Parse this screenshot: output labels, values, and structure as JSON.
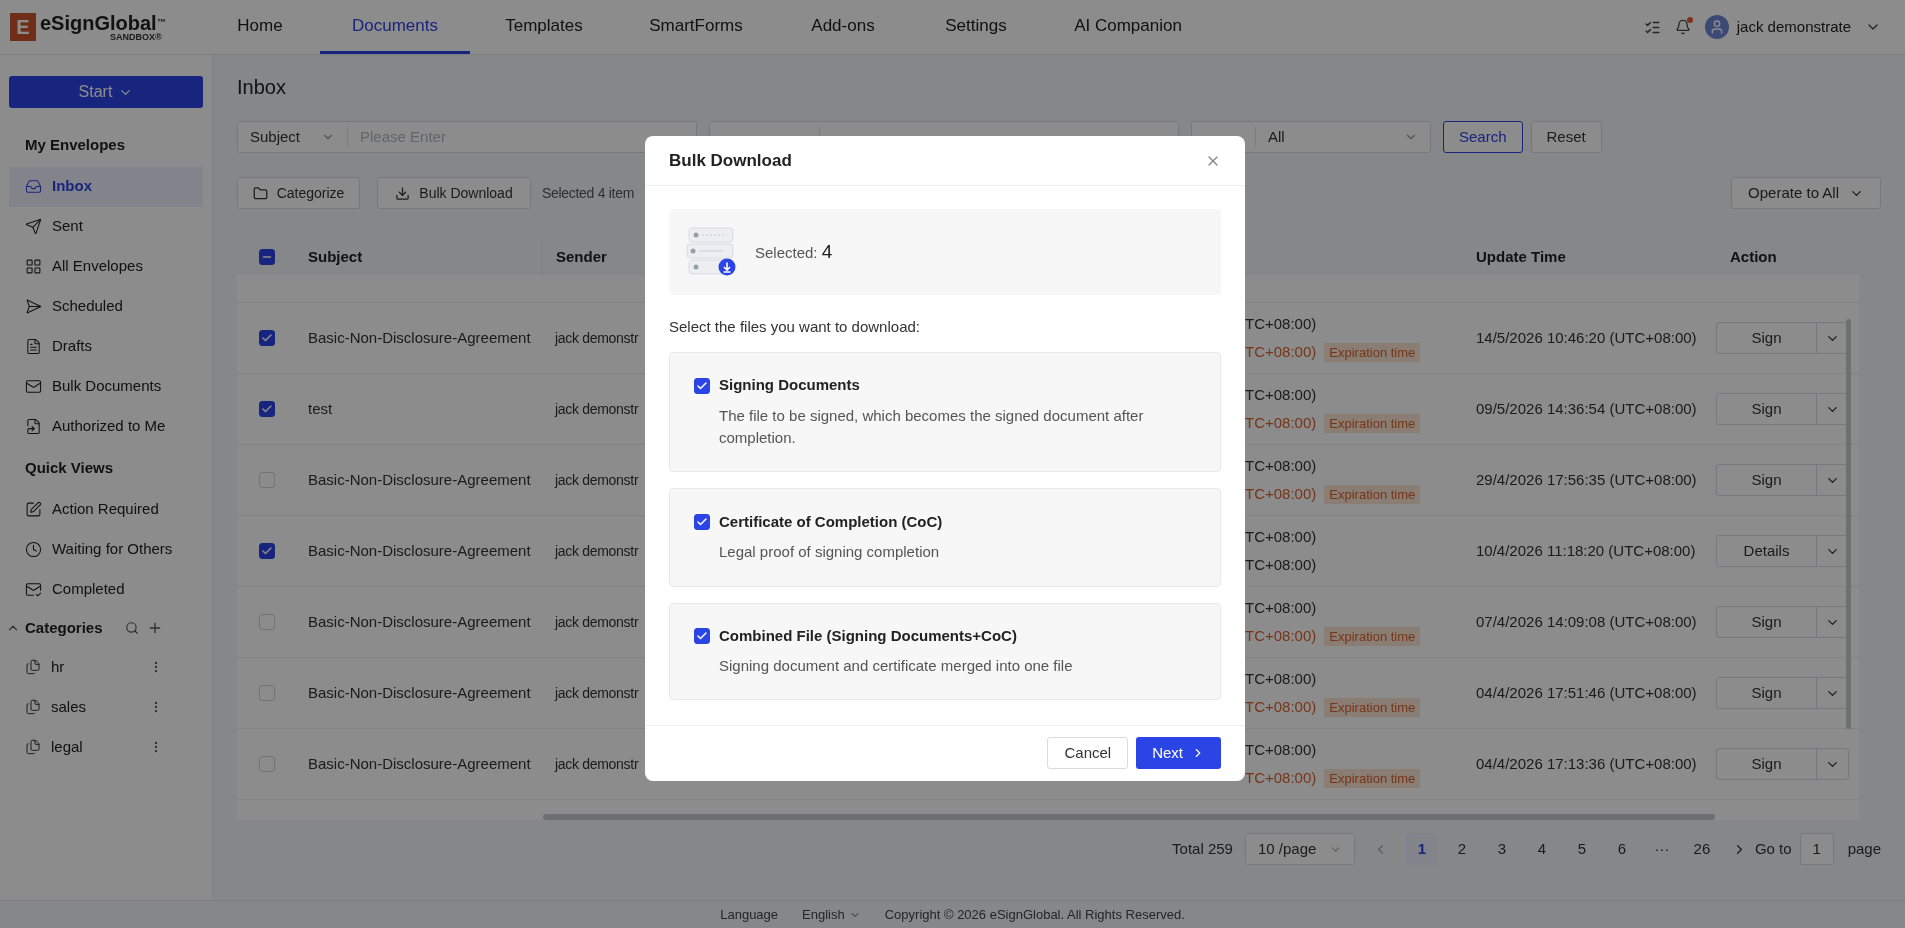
{
  "header": {
    "logo": {
      "mark": "E",
      "name": "eSignGlobal",
      "trademark": "™",
      "badge": "SANDBOX®"
    },
    "nav": [
      {
        "label": "Home",
        "selected": false
      },
      {
        "label": "Documents",
        "selected": true
      },
      {
        "label": "Templates",
        "selected": false
      },
      {
        "label": "SmartForms",
        "selected": false
      },
      {
        "label": "Add-ons",
        "selected": false
      },
      {
        "label": "Settings",
        "selected": false
      },
      {
        "label": "AI Companion",
        "selected": false
      }
    ],
    "notifications": {
      "unread": true
    },
    "user": {
      "name": "jack demonstrate"
    }
  },
  "sidebar": {
    "start_button": "Start",
    "sections": [
      {
        "title": "My Envelopes",
        "items": [
          {
            "label": "Inbox",
            "selected": true
          },
          {
            "label": "Sent",
            "selected": false
          },
          {
            "label": "All Envelopes",
            "selected": false
          },
          {
            "label": "Scheduled",
            "selected": false
          },
          {
            "label": "Drafts",
            "selected": false
          },
          {
            "label": "Bulk Documents",
            "selected": false
          },
          {
            "label": "Authorized to Me",
            "selected": false
          }
        ]
      },
      {
        "title": "Quick Views",
        "items": [
          {
            "label": "Action Required",
            "selected": false
          },
          {
            "label": "Waiting for Others",
            "selected": false
          },
          {
            "label": "Completed",
            "selected": false
          }
        ]
      }
    ],
    "categories": {
      "title": "Categories",
      "expanded": true,
      "items": [
        {
          "label": "hr"
        },
        {
          "label": "sales"
        },
        {
          "label": "legal"
        }
      ]
    }
  },
  "page": {
    "title": "Inbox",
    "filters": {
      "field_select": "Subject",
      "search_placeholder": "Please Enter",
      "status_value": "All",
      "search_button": "Search",
      "reset_button": "Reset"
    },
    "toolbar": {
      "categorize": "Categorize",
      "bulk_download": "Bulk Download",
      "selection": "Selected 4 item",
      "operate_all": "Operate to All"
    },
    "table": {
      "select_all": {
        "indeterminate": true
      },
      "columns": [
        "Subject",
        "Sender",
        "Update Time",
        "Action"
      ],
      "rows": [
        {
          "checked": true,
          "subject": "Basic-Non-Disclosure-Agreement",
          "sender": "jack demonstr",
          "time_1": "TC+08:00)",
          "time_2": "TC+08:00)",
          "expired": true,
          "tag": "Expiration time",
          "updated": "14/5/2026 10:46:20 (UTC+08:00)",
          "action": "Sign"
        },
        {
          "checked": true,
          "subject": "test",
          "sender": "jack demonstr",
          "time_1": "TC+08:00)",
          "time_2": "TC+08:00)",
          "expired": true,
          "tag": "Expiration time",
          "updated": "09/5/2026 14:36:54 (UTC+08:00)",
          "action": "Sign"
        },
        {
          "checked": false,
          "subject": "Basic-Non-Disclosure-Agreement",
          "sender": "jack demonstr",
          "time_1": "TC+08:00)",
          "time_2": "TC+08:00)",
          "expired": true,
          "tag": "Expiration time",
          "updated": "29/4/2026 17:56:35 (UTC+08:00)",
          "action": "Sign"
        },
        {
          "checked": true,
          "subject": "Basic-Non-Disclosure-Agreement",
          "sender": "jack demonstr",
          "time_1": "TC+08:00)",
          "time_2": "TC+08:00)",
          "expired": false,
          "updated": "10/4/2026 11:18:20 (UTC+08:00)",
          "action": "Details"
        },
        {
          "checked": false,
          "subject": "Basic-Non-Disclosure-Agreement",
          "sender": "jack demonstr",
          "time_1": "TC+08:00)",
          "time_2": "TC+08:00)",
          "expired": true,
          "tag": "Expiration time",
          "updated": "07/4/2026 14:09:08 (UTC+08:00)",
          "action": "Sign"
        },
        {
          "checked": false,
          "subject": "Basic-Non-Disclosure-Agreement",
          "sender": "jack demonstr",
          "time_1": "TC+08:00)",
          "time_2": "TC+08:00)",
          "expired": true,
          "tag": "Expiration time",
          "updated": "04/4/2026 17:51:46 (UTC+08:00)",
          "action": "Sign"
        },
        {
          "checked": false,
          "subject": "Basic-Non-Disclosure-Agreement",
          "sender": "jack demonstr",
          "time_1": "TC+08:00)",
          "time_2": "TC+08:00)",
          "expired": true,
          "tag": "Expiration time",
          "updated": "04/4/2026 17:13:36 (UTC+08:00)",
          "action": "Sign"
        }
      ]
    },
    "pagination": {
      "total": "Total 259",
      "page_size": "10 /page",
      "pages": [
        {
          "label": "1",
          "selected": true
        },
        {
          "label": "2",
          "selected": false
        },
        {
          "label": "3",
          "selected": false
        },
        {
          "label": "4",
          "selected": false
        },
        {
          "label": "5",
          "selected": false
        },
        {
          "label": "6",
          "selected": false
        },
        {
          "label": "···",
          "selected": false
        },
        {
          "label": "26",
          "selected": false
        }
      ],
      "goto_label": "Go to",
      "goto_value": "1",
      "page_label": "page"
    }
  },
  "footer": {
    "language_label": "Language",
    "language": "English",
    "copyright": "Copyright © 2026 eSignGlobal. All Rights Reserved."
  },
  "dialog": {
    "title": "Bulk Download",
    "selected_label": "Selected:",
    "selected_count": "4",
    "prompt": "Select the files you want to download:",
    "options": [
      {
        "checked": true,
        "title": "Signing Documents",
        "description": "The file to be signed, which becomes the signed document after completion."
      },
      {
        "checked": true,
        "title": "Certificate of Completion (CoC)",
        "description": "Legal proof of signing completion"
      },
      {
        "checked": true,
        "title": "Combined File (Signing Documents+CoC)",
        "description": "Signing document and certificate merged into one file"
      }
    ],
    "cancel": "Cancel",
    "next": "Next"
  }
}
